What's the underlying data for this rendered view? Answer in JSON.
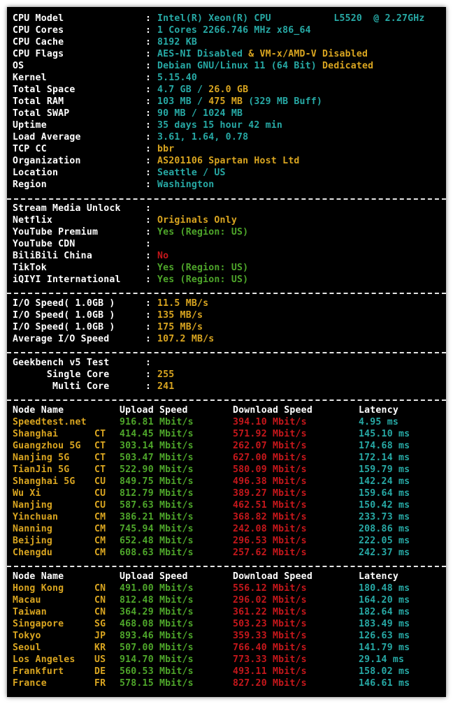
{
  "sysinfo": [
    {
      "label": "CPU Model",
      "segs": [
        {
          "t": "Intel(R) Xeon(R) CPU           L5520  @ 2.27GHz",
          "c": "cy"
        }
      ]
    },
    {
      "label": "CPU Cores",
      "segs": [
        {
          "t": "1 Cores 2266.746 MHz x86_64",
          "c": "cy"
        }
      ]
    },
    {
      "label": "CPU Cache",
      "segs": [
        {
          "t": "8192 KB",
          "c": "cy"
        }
      ]
    },
    {
      "label": "CPU Flags",
      "segs": [
        {
          "t": "AES-NI Disabled",
          "c": "cy"
        },
        {
          "t": " & ",
          "c": "ye"
        },
        {
          "t": "VM-x/AMD-V Disabled",
          "c": "ye"
        }
      ]
    },
    {
      "label": "OS",
      "segs": [
        {
          "t": "Debian GNU/Linux 11 (64 Bit) ",
          "c": "cy"
        },
        {
          "t": "Dedicated",
          "c": "ye"
        }
      ]
    },
    {
      "label": "Kernel",
      "segs": [
        {
          "t": "5.15.40",
          "c": "cy"
        }
      ]
    },
    {
      "label": "Total Space",
      "segs": [
        {
          "t": "4.7 GB / ",
          "c": "cy"
        },
        {
          "t": "26.0 GB",
          "c": "ye"
        }
      ]
    },
    {
      "label": "Total RAM",
      "segs": [
        {
          "t": "103 MB / ",
          "c": "cy"
        },
        {
          "t": "475 MB",
          "c": "ye"
        },
        {
          "t": " (329 MB Buff)",
          "c": "cy"
        }
      ]
    },
    {
      "label": "Total SWAP",
      "segs": [
        {
          "t": "90 MB / 1024 MB",
          "c": "cy"
        }
      ]
    },
    {
      "label": "Uptime",
      "segs": [
        {
          "t": "35 days 15 hour 42 min",
          "c": "cy"
        }
      ]
    },
    {
      "label": "Load Average",
      "segs": [
        {
          "t": "3.61, 1.64, 0.78",
          "c": "cy"
        }
      ]
    },
    {
      "label": "TCP CC",
      "segs": [
        {
          "t": "bbr",
          "c": "ye"
        }
      ]
    },
    {
      "label": "Organization",
      "segs": [
        {
          "t": "AS201106 Spartan Host Ltd",
          "c": "ye"
        }
      ]
    },
    {
      "label": "Location",
      "segs": [
        {
          "t": "Seattle / US",
          "c": "cy"
        }
      ]
    },
    {
      "label": "Region",
      "segs": [
        {
          "t": "Washington",
          "c": "cy"
        }
      ]
    }
  ],
  "media": [
    {
      "label": "Stream Media Unlock",
      "segs": []
    },
    {
      "label": "Netflix",
      "segs": [
        {
          "t": "Originals Only",
          "c": "ye"
        }
      ]
    },
    {
      "label": "YouTube Premium",
      "segs": [
        {
          "t": "Yes (Region: US)",
          "c": "gr"
        }
      ]
    },
    {
      "label": "YouTube CDN",
      "segs": []
    },
    {
      "label": "BiliBili China",
      "segs": [
        {
          "t": "No",
          "c": "rd"
        }
      ]
    },
    {
      "label": "TikTok",
      "segs": [
        {
          "t": "Yes (Region: US)",
          "c": "gr"
        }
      ]
    },
    {
      "label": "iQIYI International",
      "segs": [
        {
          "t": "Yes (Region: US)",
          "c": "gr"
        }
      ]
    }
  ],
  "io": [
    {
      "label": "I/O Speed( 1.0GB )",
      "segs": [
        {
          "t": "11.5 MB/s",
          "c": "ye"
        }
      ]
    },
    {
      "label": "I/O Speed( 1.0GB )",
      "segs": [
        {
          "t": "135 MB/s",
          "c": "ye"
        }
      ]
    },
    {
      "label": "I/O Speed( 1.0GB )",
      "segs": [
        {
          "t": "175 MB/s",
          "c": "ye"
        }
      ]
    },
    {
      "label": "Average I/O Speed",
      "segs": [
        {
          "t": "107.2 MB/s",
          "c": "ye"
        }
      ]
    }
  ],
  "geekbench": [
    {
      "label": "Geekbench v5 Test",
      "segs": []
    },
    {
      "label": "      Single Core",
      "segs": [
        {
          "t": "255",
          "c": "ye"
        }
      ]
    },
    {
      "label": "       Multi Core",
      "segs": [
        {
          "t": "241",
          "c": "ye"
        }
      ]
    }
  ],
  "speed_header": {
    "node": "Node Name",
    "upload": "Upload Speed",
    "download": "Download Speed",
    "latency": "Latency"
  },
  "speed_cn": [
    {
      "node": "Speedtest.net",
      "isp": "",
      "up": "916.81 Mbit/s",
      "down": "394.10 Mbit/s",
      "lat": "4.95 ms"
    },
    {
      "node": "Shanghai",
      "isp": "CT",
      "up": "414.45 Mbit/s",
      "down": "571.92 Mbit/s",
      "lat": "145.10 ms"
    },
    {
      "node": "Guangzhou 5G",
      "isp": "CT",
      "up": "303.14 Mbit/s",
      "down": "262.07 Mbit/s",
      "lat": "174.68 ms"
    },
    {
      "node": "Nanjing 5G",
      "isp": "CT",
      "up": "503.47 Mbit/s",
      "down": "627.00 Mbit/s",
      "lat": "172.14 ms"
    },
    {
      "node": "TianJin 5G",
      "isp": "CT",
      "up": "522.90 Mbit/s",
      "down": "580.09 Mbit/s",
      "lat": "159.79 ms"
    },
    {
      "node": "Shanghai 5G",
      "isp": "CU",
      "up": "849.75 Mbit/s",
      "down": "496.38 Mbit/s",
      "lat": "142.24 ms"
    },
    {
      "node": "Wu Xi",
      "isp": "CU",
      "up": "812.79 Mbit/s",
      "down": "389.27 Mbit/s",
      "lat": "159.64 ms"
    },
    {
      "node": "Nanjing",
      "isp": "CU",
      "up": "587.63 Mbit/s",
      "down": "462.51 Mbit/s",
      "lat": "150.42 ms"
    },
    {
      "node": "Yinchuan",
      "isp": "CM",
      "up": "386.21 Mbit/s",
      "down": "368.82 Mbit/s",
      "lat": "233.73 ms"
    },
    {
      "node": "Nanning",
      "isp": "CM",
      "up": "745.94 Mbit/s",
      "down": "242.08 Mbit/s",
      "lat": "208.86 ms"
    },
    {
      "node": "Beijing",
      "isp": "CM",
      "up": "652.48 Mbit/s",
      "down": "296.53 Mbit/s",
      "lat": "222.05 ms"
    },
    {
      "node": "Chengdu",
      "isp": "CM",
      "up": "608.63 Mbit/s",
      "down": "257.62 Mbit/s",
      "lat": "242.37 ms"
    }
  ],
  "speed_intl": [
    {
      "node": "Hong Kong",
      "isp": "CN",
      "up": "491.00 Mbit/s",
      "down": "556.12 Mbit/s",
      "lat": "180.48 ms"
    },
    {
      "node": "Macau",
      "isp": "CN",
      "up": "812.48 Mbit/s",
      "down": "296.02 Mbit/s",
      "lat": "164.20 ms"
    },
    {
      "node": "Taiwan",
      "isp": "CN",
      "up": "364.29 Mbit/s",
      "down": "361.22 Mbit/s",
      "lat": "182.64 ms"
    },
    {
      "node": "Singapore",
      "isp": "SG",
      "up": "468.08 Mbit/s",
      "down": "503.23 Mbit/s",
      "lat": "183.49 ms"
    },
    {
      "node": "Tokyo",
      "isp": "JP",
      "up": "893.46 Mbit/s",
      "down": "359.33 Mbit/s",
      "lat": "126.63 ms"
    },
    {
      "node": "Seoul",
      "isp": "KR",
      "up": "507.00 Mbit/s",
      "down": "766.40 Mbit/s",
      "lat": "141.79 ms"
    },
    {
      "node": "Los Angeles",
      "isp": "US",
      "up": "914.70 Mbit/s",
      "down": "773.33 Mbit/s",
      "lat": "29.14 ms"
    },
    {
      "node": "Frankfurt",
      "isp": "DE",
      "up": "560.53 Mbit/s",
      "down": "493.11 Mbit/s",
      "lat": "158.02 ms"
    },
    {
      "node": "France",
      "isp": "FR",
      "up": "578.15 Mbit/s",
      "down": "827.20 Mbit/s",
      "lat": "146.61 ms"
    }
  ],
  "colors": {
    "background": "#000000",
    "label": "#ffffff",
    "cyan": "#27a9a5",
    "yellow": "#d9a520",
    "green": "#4ea62a",
    "red": "#c5171b",
    "separator": "#e6e6e6"
  }
}
